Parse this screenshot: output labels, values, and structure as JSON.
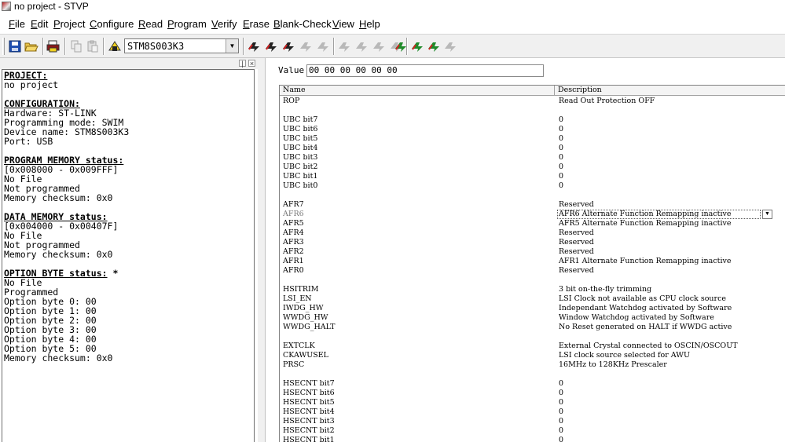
{
  "window": {
    "title": "no project - STVP"
  },
  "menu": [
    {
      "label": "File",
      "key": "F",
      "rest": "ile"
    },
    {
      "label": "Edit",
      "key": "E",
      "rest": "dit"
    },
    {
      "label": "Project",
      "key": "P",
      "rest": "roject"
    },
    {
      "label": "Configure",
      "key": "C",
      "rest": "onfigure"
    },
    {
      "label": "Read",
      "key": "R",
      "rest": "ead"
    },
    {
      "label": "Program",
      "key": "P",
      "rest": "rogram"
    },
    {
      "label": "Verify",
      "key": "V",
      "rest": "erify"
    },
    {
      "label": "Erase",
      "key": "E",
      "rest": "rase"
    },
    {
      "label": "Blank-Check",
      "key": "B",
      "rest": "lank-Check"
    },
    {
      "label": "View",
      "key": "V",
      "rest": "iew"
    },
    {
      "label": "Help",
      "key": "H",
      "rest": "elp"
    }
  ],
  "toolbar": {
    "device": "STM8S003K3",
    "icons": [
      "save-icon",
      "open-icon",
      "print-icon",
      "copy-icon",
      "paste-icon",
      "device-icon",
      "read-all-icon",
      "read-current-icon",
      "read-disabled-icon",
      "read-disabled-2-icon",
      "read-disabled-3-icon",
      "program-disabled-icon",
      "program-disabled-2-icon",
      "program-disabled-3-icon",
      "program-disabled-4-icon",
      "verify-icon",
      "verify-current-icon",
      "verify-2-icon",
      "verify-disabled-icon"
    ]
  },
  "left_panel": {
    "lines": [
      {
        "text": "PROJECT:",
        "head": true
      },
      {
        "text": "no project"
      },
      {
        "text": ""
      },
      {
        "text": "CONFIGURATION:",
        "head": true
      },
      {
        "text": "Hardware: ST-LINK"
      },
      {
        "text": "Programming mode: SWIM"
      },
      {
        "text": "Device name: STM8S003K3"
      },
      {
        "text": "Port: USB"
      },
      {
        "text": ""
      },
      {
        "text": "PROGRAM MEMORY status:",
        "head": true
      },
      {
        "text": "[0x008000 - 0x009FFF]"
      },
      {
        "text": "No File"
      },
      {
        "text": "Not programmed"
      },
      {
        "text": "Memory checksum: 0x0"
      },
      {
        "text": ""
      },
      {
        "text": "DATA MEMORY status:",
        "head": true
      },
      {
        "text": "[0x004000 - 0x00407F]"
      },
      {
        "text": "No File"
      },
      {
        "text": "Not programmed"
      },
      {
        "text": "Memory checksum: 0x0"
      },
      {
        "text": ""
      },
      {
        "text": "OPTION BYTE status:",
        "head": true,
        "suffix": " *"
      },
      {
        "text": "No File"
      },
      {
        "text": "Programmed"
      },
      {
        "text": "Option byte 0: 00"
      },
      {
        "text": "Option byte 1: 00"
      },
      {
        "text": "Option byte 2: 00"
      },
      {
        "text": "Option byte 3: 00"
      },
      {
        "text": "Option byte 4: 00"
      },
      {
        "text": "Option byte 5: 00"
      },
      {
        "text": "Memory checksum: 0x0"
      }
    ]
  },
  "right_panel": {
    "value_label": "Value",
    "value": "00 00 00 00 00 00",
    "columns": {
      "name": "Name",
      "description": "Description"
    },
    "rows": [
      {
        "name": "ROP",
        "desc": "Read Out Protection OFF"
      },
      {
        "name": "",
        "desc": ""
      },
      {
        "name": "UBC bit7",
        "desc": "0"
      },
      {
        "name": "UBC bit6",
        "desc": "0"
      },
      {
        "name": "UBC bit5",
        "desc": "0"
      },
      {
        "name": "UBC bit4",
        "desc": "0"
      },
      {
        "name": "UBC bit3",
        "desc": "0"
      },
      {
        "name": "UBC bit2",
        "desc": "0"
      },
      {
        "name": "UBC bit1",
        "desc": "0"
      },
      {
        "name": "UBC bit0",
        "desc": "0"
      },
      {
        "name": "",
        "desc": ""
      },
      {
        "name": "AFR7",
        "desc": "Reserved"
      },
      {
        "name": "AFR6",
        "desc": "AFR6 Alternate Function Remapping inactive",
        "selected": true
      },
      {
        "name": "AFR5",
        "desc": "AFR5 Alternate Function Remapping inactive"
      },
      {
        "name": "AFR4",
        "desc": "Reserved"
      },
      {
        "name": "AFR3",
        "desc": "Reserved"
      },
      {
        "name": "AFR2",
        "desc": "Reserved"
      },
      {
        "name": "AFR1",
        "desc": "AFR1 Alternate Function Remapping inactive"
      },
      {
        "name": "AFR0",
        "desc": "Reserved"
      },
      {
        "name": "",
        "desc": ""
      },
      {
        "name": "HSITRIM",
        "desc": "3 bit on-the-fly trimming"
      },
      {
        "name": "LSI_EN",
        "desc": "LSI Clock not available as CPU clock source"
      },
      {
        "name": "IWDG_HW",
        "desc": "Independant Watchdog activated by Software"
      },
      {
        "name": "WWDG_HW",
        "desc": "Window Watchdog activated by Software"
      },
      {
        "name": "WWDG_HALT",
        "desc": "No Reset generated on HALT if WWDG active"
      },
      {
        "name": "",
        "desc": ""
      },
      {
        "name": "EXTCLK",
        "desc": "External Crystal connected to OSCIN/OSCOUT"
      },
      {
        "name": "CKAWUSEL",
        "desc": "LSI clock source selected for AWU"
      },
      {
        "name": "PRSC",
        "desc": "16MHz to 128KHz Prescaler"
      },
      {
        "name": "",
        "desc": ""
      },
      {
        "name": "HSECNT bit7",
        "desc": "0"
      },
      {
        "name": "HSECNT bit6",
        "desc": "0"
      },
      {
        "name": "HSECNT bit5",
        "desc": "0"
      },
      {
        "name": "HSECNT bit4",
        "desc": "0"
      },
      {
        "name": "HSECNT bit3",
        "desc": "0"
      },
      {
        "name": "HSECNT bit2",
        "desc": "0"
      },
      {
        "name": "HSECNT bit1",
        "desc": "0"
      }
    ]
  }
}
